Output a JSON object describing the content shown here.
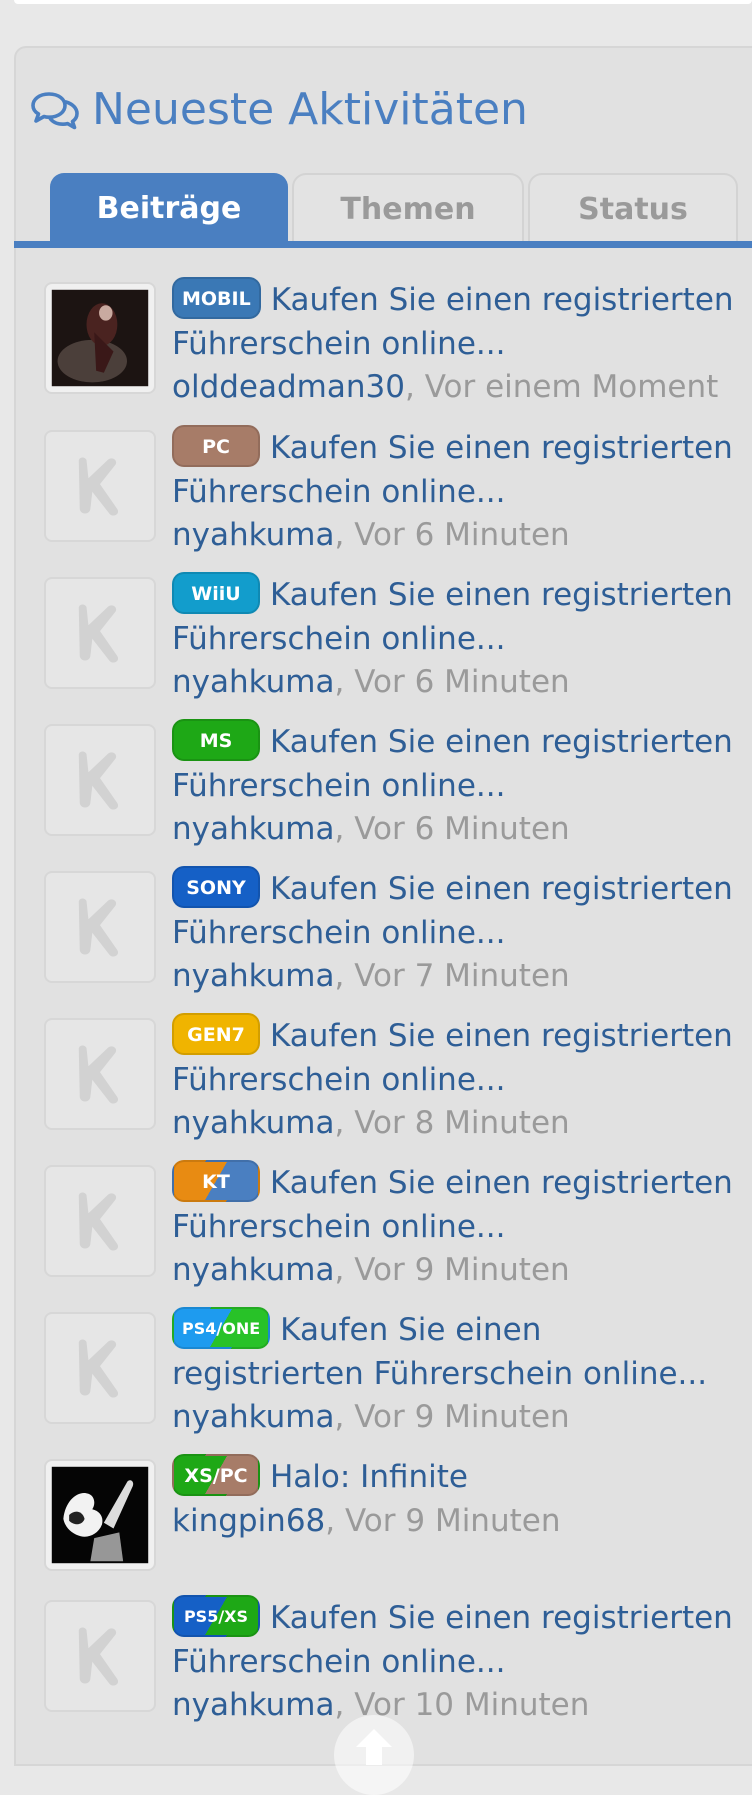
{
  "section": {
    "title": "Neueste Aktivitäten",
    "icon": "comments-icon"
  },
  "tabs": [
    {
      "label": "Beiträge",
      "active": true
    },
    {
      "label": "Themen",
      "active": false
    },
    {
      "label": "Status",
      "active": false
    }
  ],
  "items": [
    {
      "badge": "MOBIL",
      "badge_color": "#3a78b5",
      "title": "Kaufen Sie einen registrierten Führerschein online...",
      "author": "olddeadman30",
      "time": "Vor einem Moment",
      "avatar": "photo-dark"
    },
    {
      "badge": "PC",
      "badge_color": "#a77c68",
      "title": "Kaufen Sie einen registrierten Führerschein online...",
      "author": "nyahkuma",
      "time": "Vor 6 Minuten",
      "avatar": "default-k"
    },
    {
      "badge": "WiiU",
      "badge_color": "#129dcc",
      "title": "Kaufen Sie einen registrierten Führerschein online...",
      "author": "nyahkuma",
      "time": "Vor 6 Minuten",
      "avatar": "default-k"
    },
    {
      "badge": "MS",
      "badge_color": "#1ea816",
      "title": "Kaufen Sie einen registrierten Führerschein online...",
      "author": "nyahkuma",
      "time": "Vor 6 Minuten",
      "avatar": "default-k"
    },
    {
      "badge": "SONY",
      "badge_color": "#1560c6",
      "title": "Kaufen Sie einen registrierten Führerschein online...",
      "author": "nyahkuma",
      "time": "Vor 7 Minuten",
      "avatar": "default-k"
    },
    {
      "badge": "GEN7",
      "badge_color": "#f0b400",
      "title": "Kaufen Sie einen registrierten Führerschein online...",
      "author": "nyahkuma",
      "time": "Vor 8 Minuten",
      "avatar": "default-k"
    },
    {
      "badge": "KT",
      "badge_color": "#e88b12",
      "badge_color2": "#4a7fc1",
      "title": "Kaufen Sie einen registrierten Führerschein online...",
      "author": "nyahkuma",
      "time": "Vor 9 Minuten",
      "avatar": "default-k"
    },
    {
      "badge": "PS4/ONE",
      "badge_color": "#1e9bef",
      "badge_color2": "#28c228",
      "title": "Kaufen Sie einen registrierten Führerschein online...",
      "author": "nyahkuma",
      "time": "Vor 9 Minuten",
      "avatar": "default-k"
    },
    {
      "badge": "XS/PC",
      "badge_color": "#1ea816",
      "badge_color2": "#a77c68",
      "title": "Halo: Infinite",
      "author": "kingpin68",
      "time": "Vor 9 Minuten",
      "avatar": "photo-bw"
    },
    {
      "badge": "PS5/XS",
      "badge_color": "#1560c6",
      "badge_color2": "#1ea816",
      "title": "Kaufen Sie einen registrierten Führerschein online...",
      "author": "nyahkuma",
      "time": "Vor 10 Minuten",
      "avatar": "default-k"
    }
  ],
  "scroll_top": {
    "icon": "arrow-up-icon"
  },
  "colors": {
    "accent": "#4a7fc1",
    "link": "#2e5e96",
    "muted": "#9a9a9a",
    "panel": "#e1e1e1"
  }
}
